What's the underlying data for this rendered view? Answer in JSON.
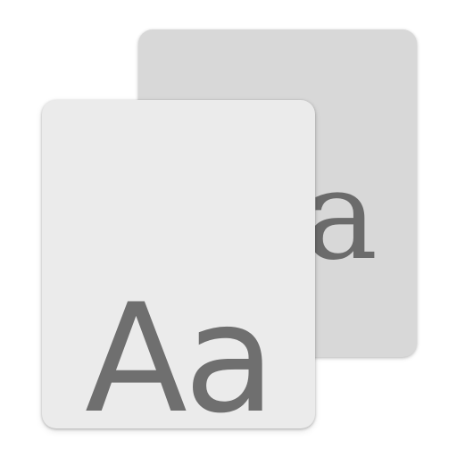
{
  "icon": {
    "name": "font-book-icon",
    "back_card": {
      "glyph": "a",
      "color": "#d8d8d8",
      "text_color": "#6b6b6b"
    },
    "front_card": {
      "glyph": "Aa",
      "color": "#ebebeb",
      "text_color": "#6f6f6f"
    }
  }
}
